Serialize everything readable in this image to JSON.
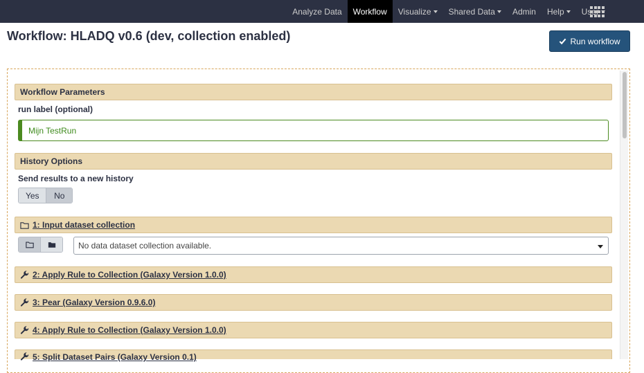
{
  "nav": {
    "items": [
      {
        "label": "Analyze Data",
        "caret": false,
        "active": false
      },
      {
        "label": "Workflow",
        "caret": false,
        "active": true
      },
      {
        "label": "Visualize",
        "caret": true,
        "active": false
      },
      {
        "label": "Shared Data",
        "caret": true,
        "active": false
      },
      {
        "label": "Admin",
        "caret": false,
        "active": false
      },
      {
        "label": "Help",
        "caret": true,
        "active": false
      },
      {
        "label": "User",
        "caret": true,
        "active": false
      }
    ],
    "apps_icon": "grid-icon"
  },
  "page": {
    "title": "Workflow: HLADQ v0.6 (dev, collection enabled)",
    "run_button": "Run workflow"
  },
  "params": {
    "header": "Workflow Parameters",
    "run_label": "run label (optional)",
    "run_label_value": "Mijn TestRun"
  },
  "history": {
    "header": "History Options",
    "send_label": "Send results to a new history",
    "yes": "Yes",
    "no": "No"
  },
  "steps": {
    "step1": "1: Input dataset collection",
    "select_value": "No data dataset collection available.",
    "step2": "2: Apply Rule to Collection (Galaxy Version 1.0.0)",
    "step3": "3: Pear (Galaxy Version 0.9.6.0)",
    "step4": "4: Apply Rule to Collection (Galaxy Version 1.0.0)",
    "step5": "5: Split Dataset Pairs (Galaxy Version 0.1)"
  },
  "colors": {
    "navbar": "#2c3143",
    "section": "#ebd9b2",
    "primary_button": "#25537b",
    "valid_input": "#4b8a20"
  }
}
